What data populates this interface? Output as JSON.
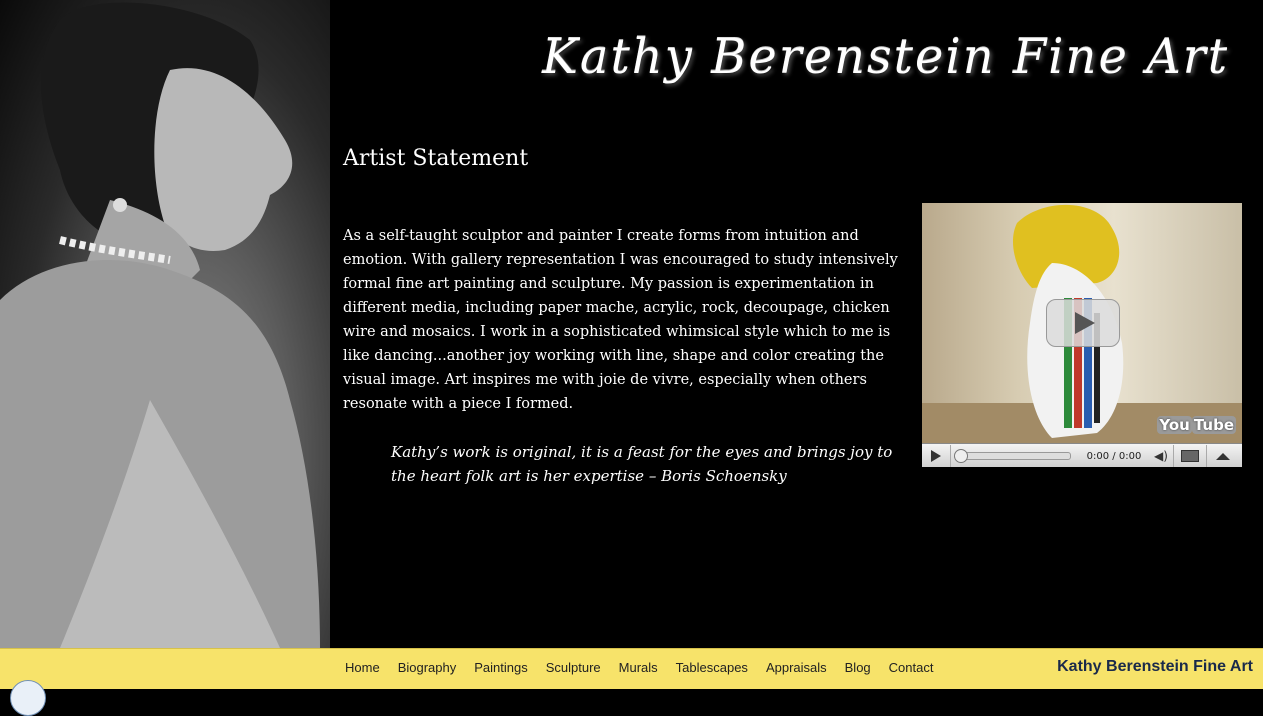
{
  "header": {
    "site_title": "Kathy Berenstein Fine Art"
  },
  "main": {
    "heading": "Artist Statement",
    "statement": "As a self-taught sculptor and painter I create forms from intuition and emotion. With gallery representation I was encouraged to study intensively formal fine art painting and sculpture.  My passion is experimentation in different media, including paper mache, acrylic, rock, decoupage, chicken wire and mosaics.  I work in a sophisticated whimsical style which to me is like dancing...another joy working with line, shape and color creating the visual image.  Art inspires me with joie de vivre, especially when others resonate with a piece I formed.",
    "quote": "Kathy’s work is original, it is a feast for the eyes and brings joy to the heart folk art is her expertise – Boris Schoensky"
  },
  "video": {
    "logo_you": "You",
    "logo_tube": "Tube",
    "time": "0:00 / 0:00",
    "volume_icon": "speaker-icon",
    "play_icon": "play-icon"
  },
  "nav": {
    "items": [
      "Home",
      "Biography",
      "Paintings",
      "Sculpture",
      "Murals",
      "Tablescapes",
      "Appraisals",
      "Blog",
      "Contact"
    ]
  },
  "footer": {
    "brand": "Kathy Berenstein Fine Art"
  },
  "colors": {
    "nav_bg": "#f7e36a",
    "page_bg": "#000000",
    "brand_text": "#1a2a4a"
  }
}
